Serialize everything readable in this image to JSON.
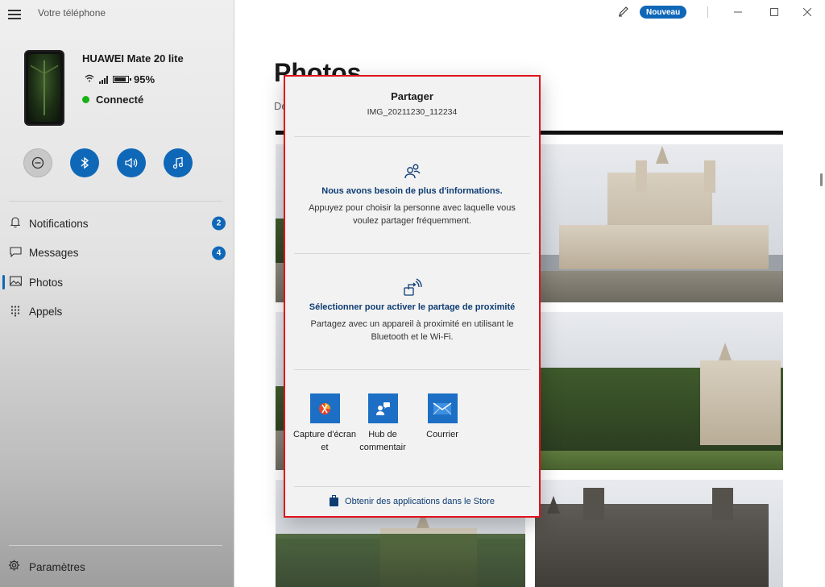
{
  "app": {
    "title": "Votre téléphone"
  },
  "device": {
    "name": "HUAWEI Mate 20 lite",
    "battery": "95%",
    "status": "Connecté"
  },
  "nav": {
    "items": [
      {
        "label": "Notifications",
        "badge": "2",
        "icon": "bell-icon"
      },
      {
        "label": "Messages",
        "badge": "4",
        "icon": "chat-icon"
      },
      {
        "label": "Photos",
        "badge": "",
        "icon": "image-icon"
      },
      {
        "label": "Appels",
        "badge": "",
        "icon": "dialpad-icon"
      }
    ],
    "settings": "Paramètres"
  },
  "titlebar": {
    "new_label": "Nouveau"
  },
  "main": {
    "title": "Photos",
    "subtitle": "De"
  },
  "share": {
    "title": "Partager",
    "filename": "IMG_20211230_112234",
    "section1": {
      "title": "Nous avons besoin de plus d'informations.",
      "desc": "Appuyez pour choisir la personne avec laquelle vous voulez partager fréquemment."
    },
    "section2": {
      "title": "Sélectionner pour activer le partage de proximité",
      "desc": "Partagez avec un appareil à proximité en utilisant le Bluetooth et le Wi-Fi."
    },
    "apps": [
      {
        "label": "Capture d'écran et",
        "icon": "snip-icon"
      },
      {
        "label": "Hub de commentair",
        "icon": "feedback-icon"
      },
      {
        "label": "Courrier",
        "icon": "mail-icon"
      }
    ],
    "store": "Obtenir des applications dans le Store"
  },
  "colors": {
    "accent": "#0f67b8",
    "highlight_border": "#e0121b",
    "connected": "#16b216",
    "link": "#0d3c73"
  }
}
